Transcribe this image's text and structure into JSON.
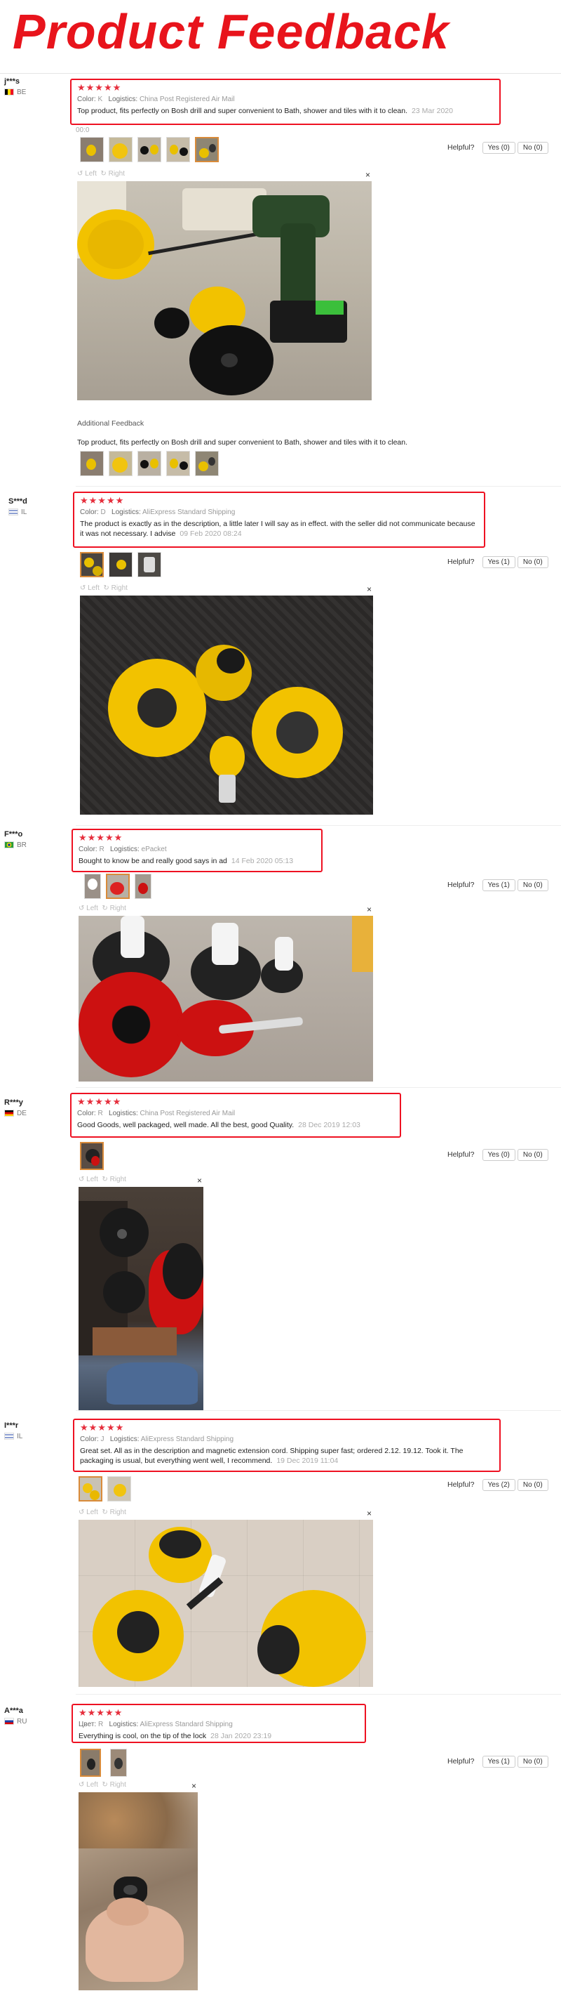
{
  "header": {
    "title": "Product Feedback"
  },
  "common": {
    "rotate_left": "Left",
    "rotate_right": "Right",
    "helpful": "Helpful?",
    "close": "×",
    "stars": "★★★★★"
  },
  "reviews": [
    {
      "user": "j***s",
      "country": "BE",
      "color_label": "Color:",
      "color": "K",
      "logistics_label": "Logistics:",
      "logistics": "China Post Registered Air Mail",
      "text": "Top product, fits perfectly on Bosh drill and super convenient to Bath, shower and tiles with it to clean.",
      "date": "23 Mar 2020",
      "date2": "00:0",
      "yes": "Yes (0)",
      "no": "No (0)",
      "additional_label": "Additional Feedback",
      "additional_text": "Top product, fits perfectly on Bosh drill and super convenient to Bath, shower and tiles with it to clean."
    },
    {
      "user": "S***d",
      "country": "IL",
      "color_label": "Color:",
      "color": "D",
      "logistics_label": "Logistics:",
      "logistics": "AliExpress Standard Shipping",
      "text": "The product is exactly as in the description, a little later I will say as in effect. with the seller did not communicate because it was not necessary. I advise",
      "date": "09 Feb 2020 08:24",
      "yes": "Yes (1)",
      "no": "No (0)"
    },
    {
      "user": "F***o",
      "country": "BR",
      "color_label": "Color:",
      "color": "R",
      "logistics_label": "Logistics:",
      "logistics": "ePacket",
      "text": "Bought to know be and really good says in ad",
      "date": "14 Feb 2020 05:13",
      "yes": "Yes (1)",
      "no": "No (0)"
    },
    {
      "user": "R***y",
      "country": "DE",
      "color_label": "Color:",
      "color": "R",
      "logistics_label": "Logistics:",
      "logistics": "China Post Registered Air Mail",
      "text": "Good Goods, well packaged, well made. All the best, good Quality.",
      "date": "28 Dec 2019 12:03",
      "yes": "Yes (0)",
      "no": "No (0)"
    },
    {
      "user": "I***r",
      "country": "IL",
      "color_label": "Color:",
      "color": "J",
      "logistics_label": "Logistics:",
      "logistics": "AliExpress Standard Shipping",
      "text": "Great set. All as in the description and magnetic extension cord. Shipping super fast; ordered 2.12. 19.12. Took it. The packaging is usual, but everything went well, I recommend.",
      "date": "19 Dec 2019 11:04",
      "yes": "Yes (2)",
      "no": "No (0)"
    },
    {
      "user": "A***a",
      "country": "RU",
      "color_label": "Цвет:",
      "color": "R",
      "logistics_label": "Logistics:",
      "logistics": "AliExpress Standard Shipping",
      "text": "Everything is cool, on the tip of the lock",
      "date": "28 Jan 2020 23:19",
      "yes": "Yes (1)",
      "no": "No (0)"
    }
  ]
}
